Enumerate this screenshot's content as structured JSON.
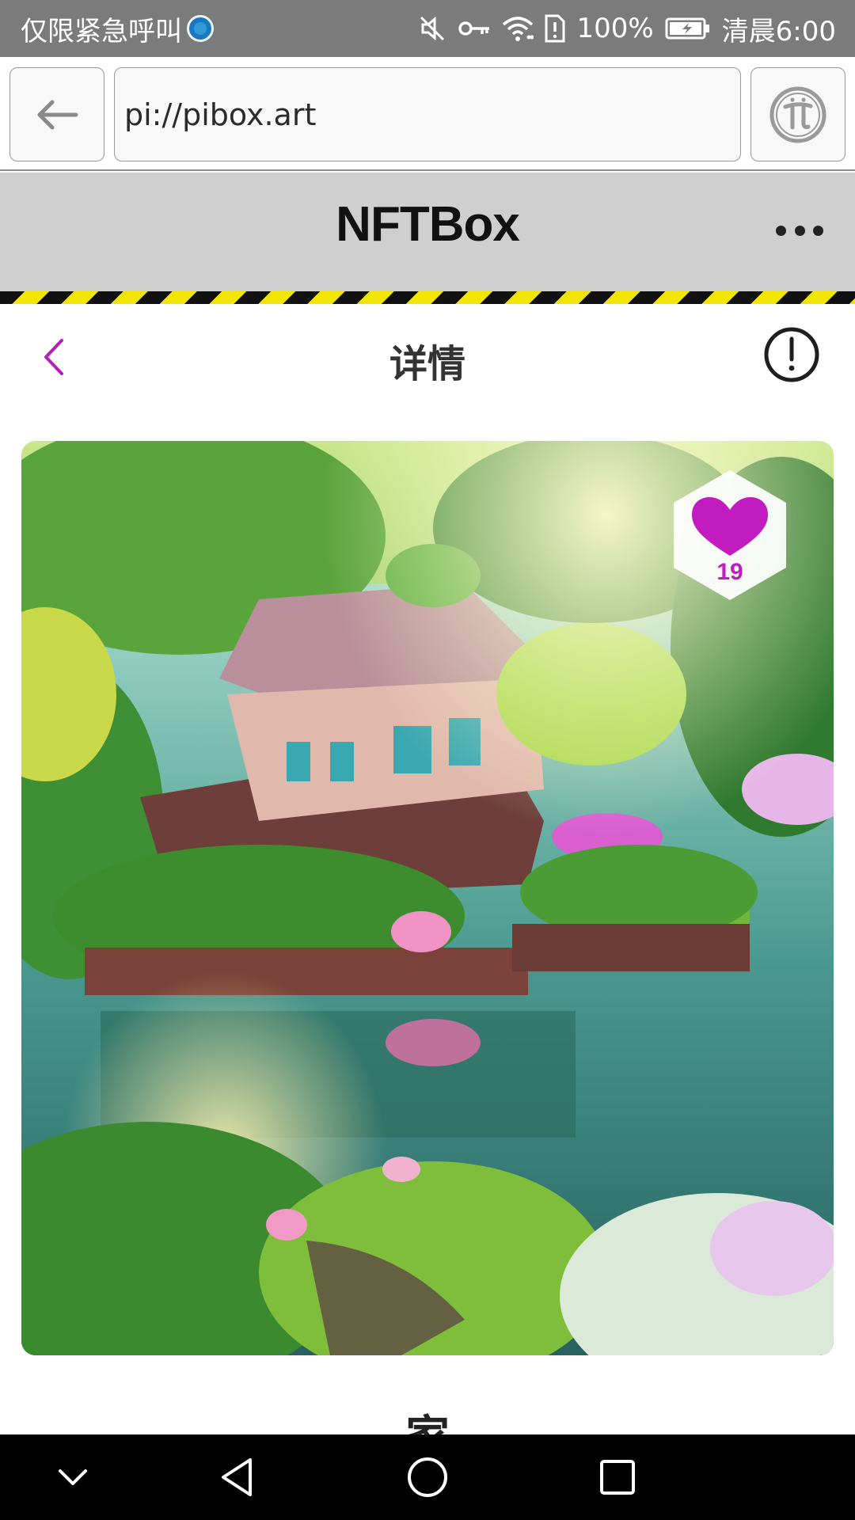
{
  "status_bar": {
    "left_text": "仅限紧急呼叫",
    "battery_text": "100%",
    "time_text": "清晨6:00",
    "icons": [
      "hd-call-icon",
      "mute-icon",
      "key-icon",
      "wifi-icon",
      "sim-alert-icon",
      "battery-icon"
    ]
  },
  "browser": {
    "url": "pi://pibox.art",
    "back_icon": "arrow-left-icon",
    "pi_icon": "pi-logo-icon"
  },
  "app_header": {
    "title": "NFTBox",
    "more_icon": "more-dots-icon"
  },
  "detail": {
    "title": "详情",
    "back_icon": "chevron-left-icon",
    "info_icon": "exclamation-circle-icon"
  },
  "artwork": {
    "like_count": "19",
    "like_icon": "heart-icon"
  },
  "nft": {
    "title_partial": "家"
  },
  "nav_bar": {
    "icons": [
      "chevron-down-icon",
      "back-triangle-icon",
      "home-circle-icon",
      "recents-square-icon"
    ]
  },
  "colors": {
    "accent": "#c21bc0",
    "status_bar": "#7b7b7b",
    "header_bg": "#cfcfcf",
    "hazard_yellow": "#f2e600"
  }
}
